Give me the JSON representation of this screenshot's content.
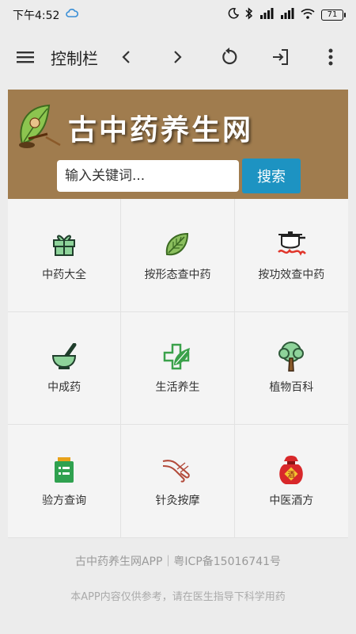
{
  "status_bar": {
    "time": "下午4:52",
    "battery": "71"
  },
  "toolbar": {
    "title": "控制栏"
  },
  "banner": {
    "site_name": "古中药养生网"
  },
  "search": {
    "placeholder": "输入关键词...",
    "button_label": "搜索"
  },
  "categories": [
    {
      "label": "中药大全",
      "icon": "gift-herb-icon"
    },
    {
      "label": "按形态查中药",
      "icon": "leaf-icon"
    },
    {
      "label": "按功效查中药",
      "icon": "pot-icon"
    },
    {
      "label": "中成药",
      "icon": "mortar-icon"
    },
    {
      "label": "生活养生",
      "icon": "health-cross-icon"
    },
    {
      "label": "植物百科",
      "icon": "tree-icon"
    },
    {
      "label": "验方查询",
      "icon": "prescription-icon"
    },
    {
      "label": "针灸按摩",
      "icon": "massage-hand-icon"
    },
    {
      "label": "中医酒方",
      "icon": "wine-jar-icon"
    }
  ],
  "footer": {
    "line1": "古中药养生网APP｜粤ICP备15016741号",
    "line2": "本APP内容仅供参考，请在医生指导下科学用药"
  },
  "colors": {
    "banner_bg": "#a07c4e",
    "search_button_bg": "#1d93c2",
    "green_icon": "#3aa14a",
    "red_icon": "#d8282a"
  }
}
